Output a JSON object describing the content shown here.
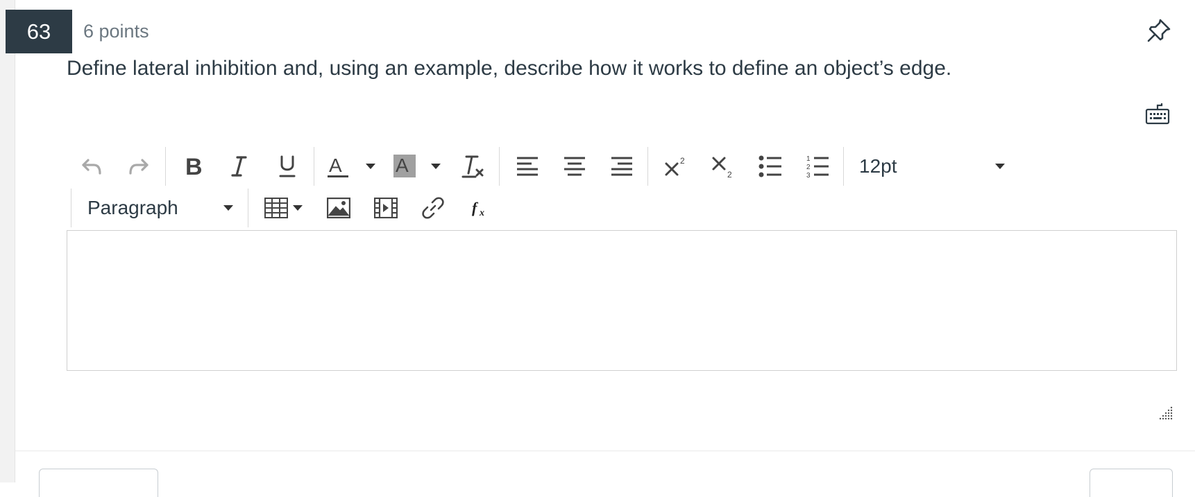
{
  "question": {
    "number": "63",
    "points_label": "6 points",
    "text": "Define lateral inhibition and, using an example, describe how it works to define an object’s edge."
  },
  "toolbar": {
    "font_size_value": "12pt",
    "block_format_value": "Paragraph",
    "icons": [
      "undo-icon",
      "redo-icon",
      "bold-icon",
      "italic-icon",
      "underline-icon",
      "text-color-icon",
      "background-color-icon",
      "clear-formatting-icon",
      "align-left-icon",
      "align-center-icon",
      "align-right-icon",
      "superscript-icon",
      "subscript-icon",
      "bullet-list-icon",
      "numbered-list-icon",
      "table-icon",
      "image-icon",
      "media-icon",
      "link-icon",
      "equation-icon"
    ]
  },
  "colors": {
    "question_badge_bg": "#2d3b45",
    "text": "#2d3b45",
    "muted": "#6b7780",
    "highlight_grey": "#a0a0a0"
  }
}
